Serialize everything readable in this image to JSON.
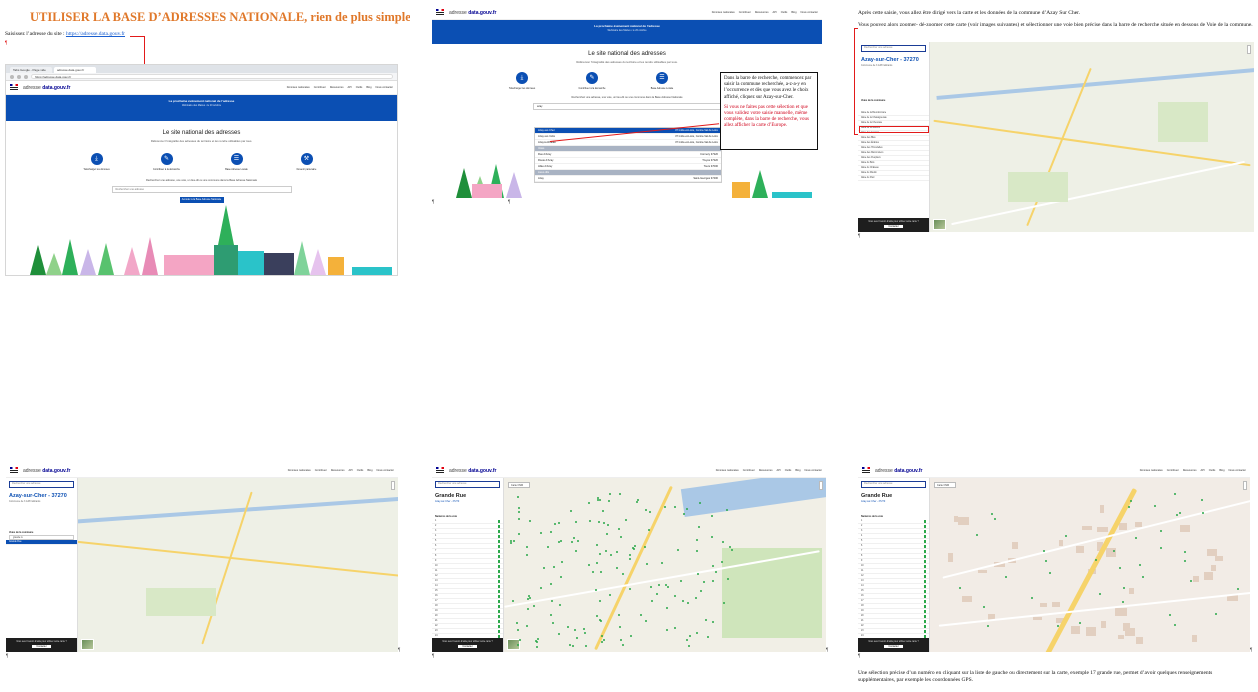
{
  "doc": {
    "title": "UTILISER LA BASE D’ADRESSES NATIONALE, rien de plus simple",
    "intro_prefix": "Saisissez l’adresse du site :",
    "intro_link": "https://adresse.data.gouv.fr",
    "para_map_1": "Après cette saisie, vous allez être dirigé vers la carte et les données de la commune d’Azay Sur Cher.",
    "para_map_2": "Vous pouvez alors zoomer- dé-zoomer cette carte (voir images suivantes) et sélectionner une voie bien précise dans la barre de recherche située en dessous de Voie de la commune.",
    "para_bottom": "Une sélection précise d’un numéro en cliquant sur la liste de gauche ou directement sur la carte, exemple 17 grande rue, permet d’avoir quelques renseignements supplémentaires, par exemple les coordonnées GPS."
  },
  "note": {
    "black": "Dans la barre de recherche, commencez par saisir la commune recherchée, a-z-a-y en l’occurrence et dès que vous avez le choix affiché, cliquez sur Azay-sur-Cher.",
    "red": "Si vous ne faites pas cette sélection et que vous validez votre saisie manuelle, même complète, dans la barre de recherche, vous allez afficher la carte d’Europe."
  },
  "browser": {
    "tab1": "Tabs Google - Page vide",
    "tab2": "adresse.data.gouv.fr",
    "url": "https://adresse.data.gouv.fr"
  },
  "site": {
    "brand_prefix": "adresse",
    "brand_main": "data.gouv.fr",
    "menu": [
      "Données nationales",
      "Contribuer",
      "Ressources",
      "API",
      "Outils",
      "Blog",
      "Nous contacter"
    ],
    "banner_title": "La prochaine événement national de l’adresse",
    "banner_sub": "Webinaire des Maires • le 20 octobre",
    "hero_title": "Le site national des adresses",
    "hero_sub": "Référencer l’intégralité des adresses du territoire et les rendre utilisables par tous.",
    "services": [
      {
        "label": "Télécharger les données",
        "icon": "download-icon",
        "glyph": "⤓"
      },
      {
        "label": "Contribuer à la démarche",
        "icon": "pencil-icon",
        "glyph": "✎"
      },
      {
        "label": "Base Adresse Locale",
        "icon": "database-icon",
        "glyph": "☰"
      },
      {
        "label": "Devenir partenaire",
        "icon": "tools-icon",
        "glyph": "⚒"
      }
    ],
    "search_hint": "Recherchez une adresse, une voie, un lieu-dit ou une commune dans la Base Adresse Nationale",
    "search_placeholder": "Rechercher une adresse",
    "search_typed": "azay",
    "cta": "Accéder à la Base Adresse Nationale"
  },
  "dropdown": {
    "rows": [
      {
        "name": "Azay-sur-Cher",
        "dept": "37 Indre-et-Loire, Centre-Val de Loire",
        "state": "sel"
      },
      {
        "name": "Azay-sur-Indre",
        "dept": "37 Indre-et-Loire, Centre-Val de Loire",
        "state": ""
      },
      {
        "name": "Azay-le-Rideau",
        "dept": "37 Indre-et-Loire, Centre-Val de Loire",
        "state": ""
      },
      {
        "name": "Voies",
        "dept": "",
        "state": "head"
      },
      {
        "name": "Rue d’Azay",
        "dept": "Cormery 37320",
        "state": ""
      },
      {
        "name": "Route d’Azay",
        "dept": "Truyes 37320",
        "state": ""
      },
      {
        "name": "Allée d’Azay",
        "dept": "Tours 37000",
        "state": ""
      },
      {
        "name": "Lieux-dits",
        "dept": "",
        "state": "head"
      },
      {
        "name": "Azay",
        "dept": "Saint-Georges 37400",
        "state": ""
      }
    ]
  },
  "map_panel": {
    "search_placeholder": "Rechercher une adresse",
    "commune": "Azay-sur-Cher - 37270",
    "commune_sub": "Commune de 3 128 habitants",
    "voies_title": "Voies de la commune",
    "voies": [
      "Allée de la Bourdonnière",
      "Allée de la Chataigneraie",
      "Allée de la Chesnaie",
      "Allée de la Garène",
      "Allée des Acacias",
      "Allée des Blés",
      "Allée des Érables",
      "Allée des Hirondelles",
      "Allée des Marronniers",
      "Allée des Peupliers",
      "Allée du Bois",
      "Allée du Château",
      "Allée du Moulin",
      "Allée du Parc"
    ],
    "filtered_input": "grande ru",
    "filtered_result": "Grande Rue",
    "footer_text": "Vous avez besoin d’aide pour utiliser cette carte ?",
    "footer_btn": "Contacter",
    "layer": "Carte OSM"
  },
  "voie_panel": {
    "title": "Grande Rue",
    "sub": "Azay-sur-Cher - 37270",
    "count_label": "Numéros de la voie",
    "numbers": [
      "1",
      "2",
      "3",
      "4",
      "5",
      "6",
      "7",
      "8",
      "9",
      "10",
      "11",
      "12",
      "13",
      "14",
      "15",
      "16",
      "17",
      "18",
      "19",
      "20",
      "21",
      "22",
      "23",
      "24"
    ]
  },
  "colors": {
    "title_orange": "#e0782a",
    "dsfr_blue": "#0b4fb3",
    "note_red": "#d0021b",
    "address_green": "#2aa84a"
  }
}
